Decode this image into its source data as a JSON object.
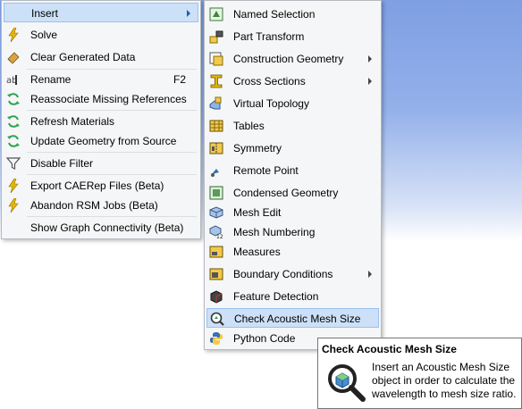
{
  "main_menu": {
    "insert": "Insert",
    "solve": "Solve",
    "clear_generated": "Clear Generated Data",
    "rename": "Rename",
    "rename_shortcut": "F2",
    "reassociate": "Reassociate Missing References",
    "refresh_materials": "Refresh Materials",
    "update_geometry": "Update Geometry from Source",
    "disable_filter": "Disable Filter",
    "export_caerep": "Export CAERep Files (Beta)",
    "abandon_rsm": "Abandon RSM Jobs (Beta)",
    "show_graph": "Show Graph Connectivity (Beta)"
  },
  "sub_menu": {
    "named_selection": "Named Selection",
    "part_transform": "Part Transform",
    "construction_geometry": "Construction Geometry",
    "cross_sections": "Cross Sections",
    "virtual_topology": "Virtual Topology",
    "tables": "Tables",
    "symmetry": "Symmetry",
    "remote_point": "Remote Point",
    "condensed_geometry": "Condensed Geometry",
    "mesh_edit": "Mesh Edit",
    "mesh_numbering": "Mesh Numbering",
    "measures": "Measures",
    "boundary_conditions": "Boundary Conditions",
    "feature_detection": "Feature Detection",
    "check_acoustic": "Check Acoustic Mesh Size",
    "python_code": "Python Code"
  },
  "tooltip": {
    "title": "Check Acoustic Mesh Size",
    "body": "Insert an Acoustic Mesh Size object in order to calculate the wavelength to mesh size ratio."
  },
  "colors": {
    "highlight": "#cce0f7",
    "highlight_border": "#99c2ef",
    "menu_bg": "#f5f6f7",
    "bolt": "#e0b000",
    "refresh": "#2ea44f"
  }
}
